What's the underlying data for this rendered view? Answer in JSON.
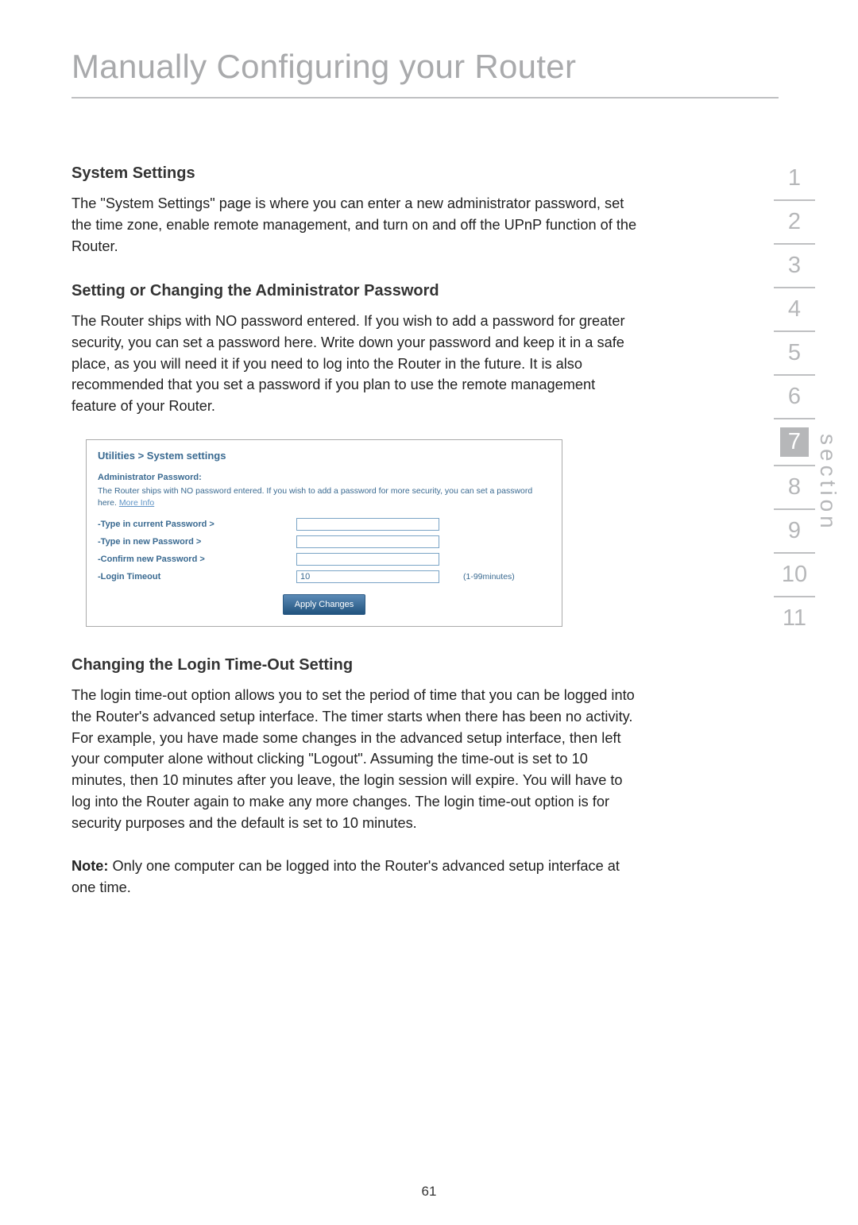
{
  "pageTitle": "Manually Configuring your Router",
  "sec1": {
    "heading": "System Settings",
    "para": "The \"System Settings\" page is where you can enter a new administrator password, set the time zone, enable remote management, and turn on and off the UPnP function of the Router."
  },
  "sec2": {
    "heading": "Setting or Changing the Administrator Password",
    "para": "The Router ships with NO password entered. If you wish to add a password for greater security, you can set a password here. Write down your password and keep it in a safe place, as you will need it if you need to log into the Router in the future. It is also recommended that you set a password if you plan to use the remote management feature of your Router."
  },
  "shot": {
    "title": "Utilities > System settings",
    "subhead": "Administrator Password:",
    "descPrefix": "The Router ships with NO password entered. If you wish to add a password for more security, you can set a password here. ",
    "moreInfo": "More Info",
    "rowCurrent": "-Type in current Password >",
    "rowNew": "-Type in new Password >",
    "rowConfirm": "-Confirm new Password >",
    "rowTimeout": "-Login Timeout",
    "timeoutValue": "10",
    "timeoutUnit": "(1-99minutes)",
    "apply": "Apply Changes"
  },
  "sec3": {
    "heading": "Changing the Login Time-Out Setting",
    "para": "The login time-out option allows you to set the period of time that you can be logged into the Router's advanced setup interface. The timer starts when there has been no activity. For example, you have made some changes in the advanced setup interface, then left your computer alone without clicking \"Logout\". Assuming the time-out is set to 10 minutes, then 10 minutes after you leave, the login session will expire. You will have to log into the Router again to make any more changes. The login time-out option is for security purposes and the default is set to 10 minutes."
  },
  "note": {
    "label": "Note:",
    "text": " Only one computer can be logged into the Router's advanced setup interface at one time."
  },
  "nav": {
    "items": [
      "1",
      "2",
      "3",
      "4",
      "5",
      "6",
      "7",
      "8",
      "9",
      "10",
      "11"
    ],
    "current": "7",
    "label": "section"
  },
  "pageNumber": "61"
}
